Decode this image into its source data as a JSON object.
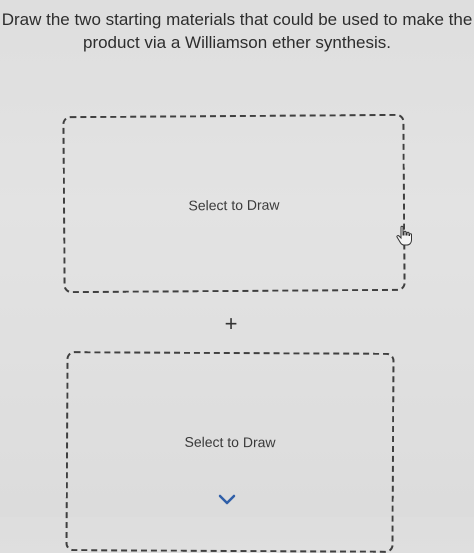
{
  "question": {
    "line1": "Draw the two starting materials that could be used to make the",
    "line2": "product via a Williamson ether synthesis."
  },
  "drawing_area_1": {
    "label": "Select to Draw"
  },
  "separator": {
    "symbol": "+"
  },
  "drawing_area_2": {
    "label": "Select to Draw"
  },
  "icons": {
    "cursor": "hand-pointer-icon",
    "scroll": "chevron-down-icon"
  }
}
